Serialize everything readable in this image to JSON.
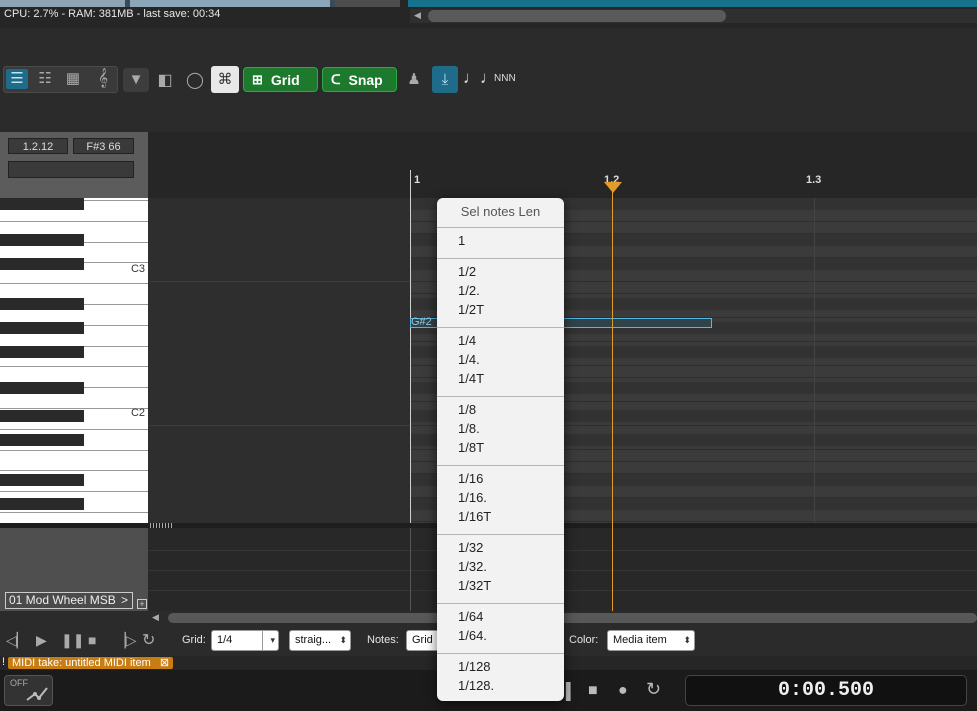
{
  "status": {
    "text": "CPU: 2.7% - RAM: 381MB -  last save: 00:34"
  },
  "toolbar": {
    "grid_label": "Grid",
    "snap_label": "Snap",
    "note_name_label": "NNN"
  },
  "piano_header": {
    "position": "1.2.12",
    "note_info": "F#3  66"
  },
  "keys": {
    "c3": "C3",
    "c2": "C2"
  },
  "ruler": {
    "marks": [
      "1",
      "1.2",
      "1.3"
    ]
  },
  "note": {
    "label": "G#2"
  },
  "cc_lane": {
    "selector": "01 Mod Wheel MSB",
    "chevron": ">",
    "add": "+"
  },
  "menu": {
    "title": "Sel notes Len",
    "groups": [
      [
        "1"
      ],
      [
        "1/2",
        "1/2.",
        "1/2T"
      ],
      [
        "1/4",
        "1/4.",
        "1/4T"
      ],
      [
        "1/8",
        "1/8.",
        "1/8T"
      ],
      [
        "1/16",
        "1/16.",
        "1/16T"
      ],
      [
        "1/32",
        "1/32.",
        "1/32T"
      ],
      [
        "1/64",
        "1/64."
      ],
      [
        "1/128",
        "1/128."
      ]
    ]
  },
  "transport": {
    "grid_label": "Grid:",
    "grid_value": "1/4",
    "swing_value": "straig...",
    "notes_label": "Notes:",
    "notes_value": "Grid",
    "color_label": "Color:",
    "color_value": "Media item"
  },
  "take": {
    "bang": "!",
    "label": "MIDI take: untitled MIDI item",
    "close": "⊠"
  },
  "bottom": {
    "off_label": "OFF",
    "time": "0:00.500"
  },
  "colors": {
    "accent_green": "#1d7a2c",
    "note_outline": "#56b7df",
    "play_cursor": "#e39b2a",
    "take_orange": "#c87d12"
  }
}
